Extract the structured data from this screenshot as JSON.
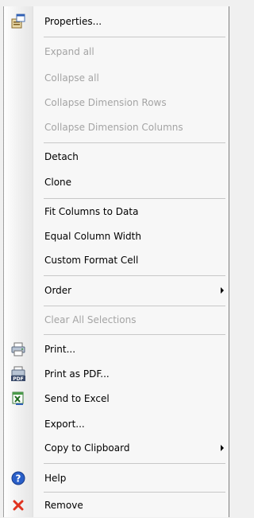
{
  "menu": {
    "items": [
      {
        "label": "Properties...",
        "icon": "properties-icon"
      },
      {
        "label": "Expand all"
      },
      {
        "label": "Collapse all"
      },
      {
        "label": "Collapse Dimension Rows"
      },
      {
        "label": "Collapse Dimension Columns"
      },
      {
        "label": "Detach"
      },
      {
        "label": "Clone"
      },
      {
        "label": "Fit Columns to Data"
      },
      {
        "label": "Equal Column Width"
      },
      {
        "label": "Custom Format Cell"
      },
      {
        "label": "Order"
      },
      {
        "label": "Clear All Selections"
      },
      {
        "label": "Print...",
        "icon": "printer-icon"
      },
      {
        "label": "Print as PDF...",
        "icon": "pdf-printer-icon"
      },
      {
        "label": "Send to Excel",
        "icon": "excel-icon"
      },
      {
        "label": "Export..."
      },
      {
        "label": "Copy to Clipboard"
      },
      {
        "label": "Help",
        "icon": "help-icon"
      },
      {
        "label": "Remove",
        "icon": "remove-icon"
      }
    ]
  },
  "pdf_badge": "PDF"
}
